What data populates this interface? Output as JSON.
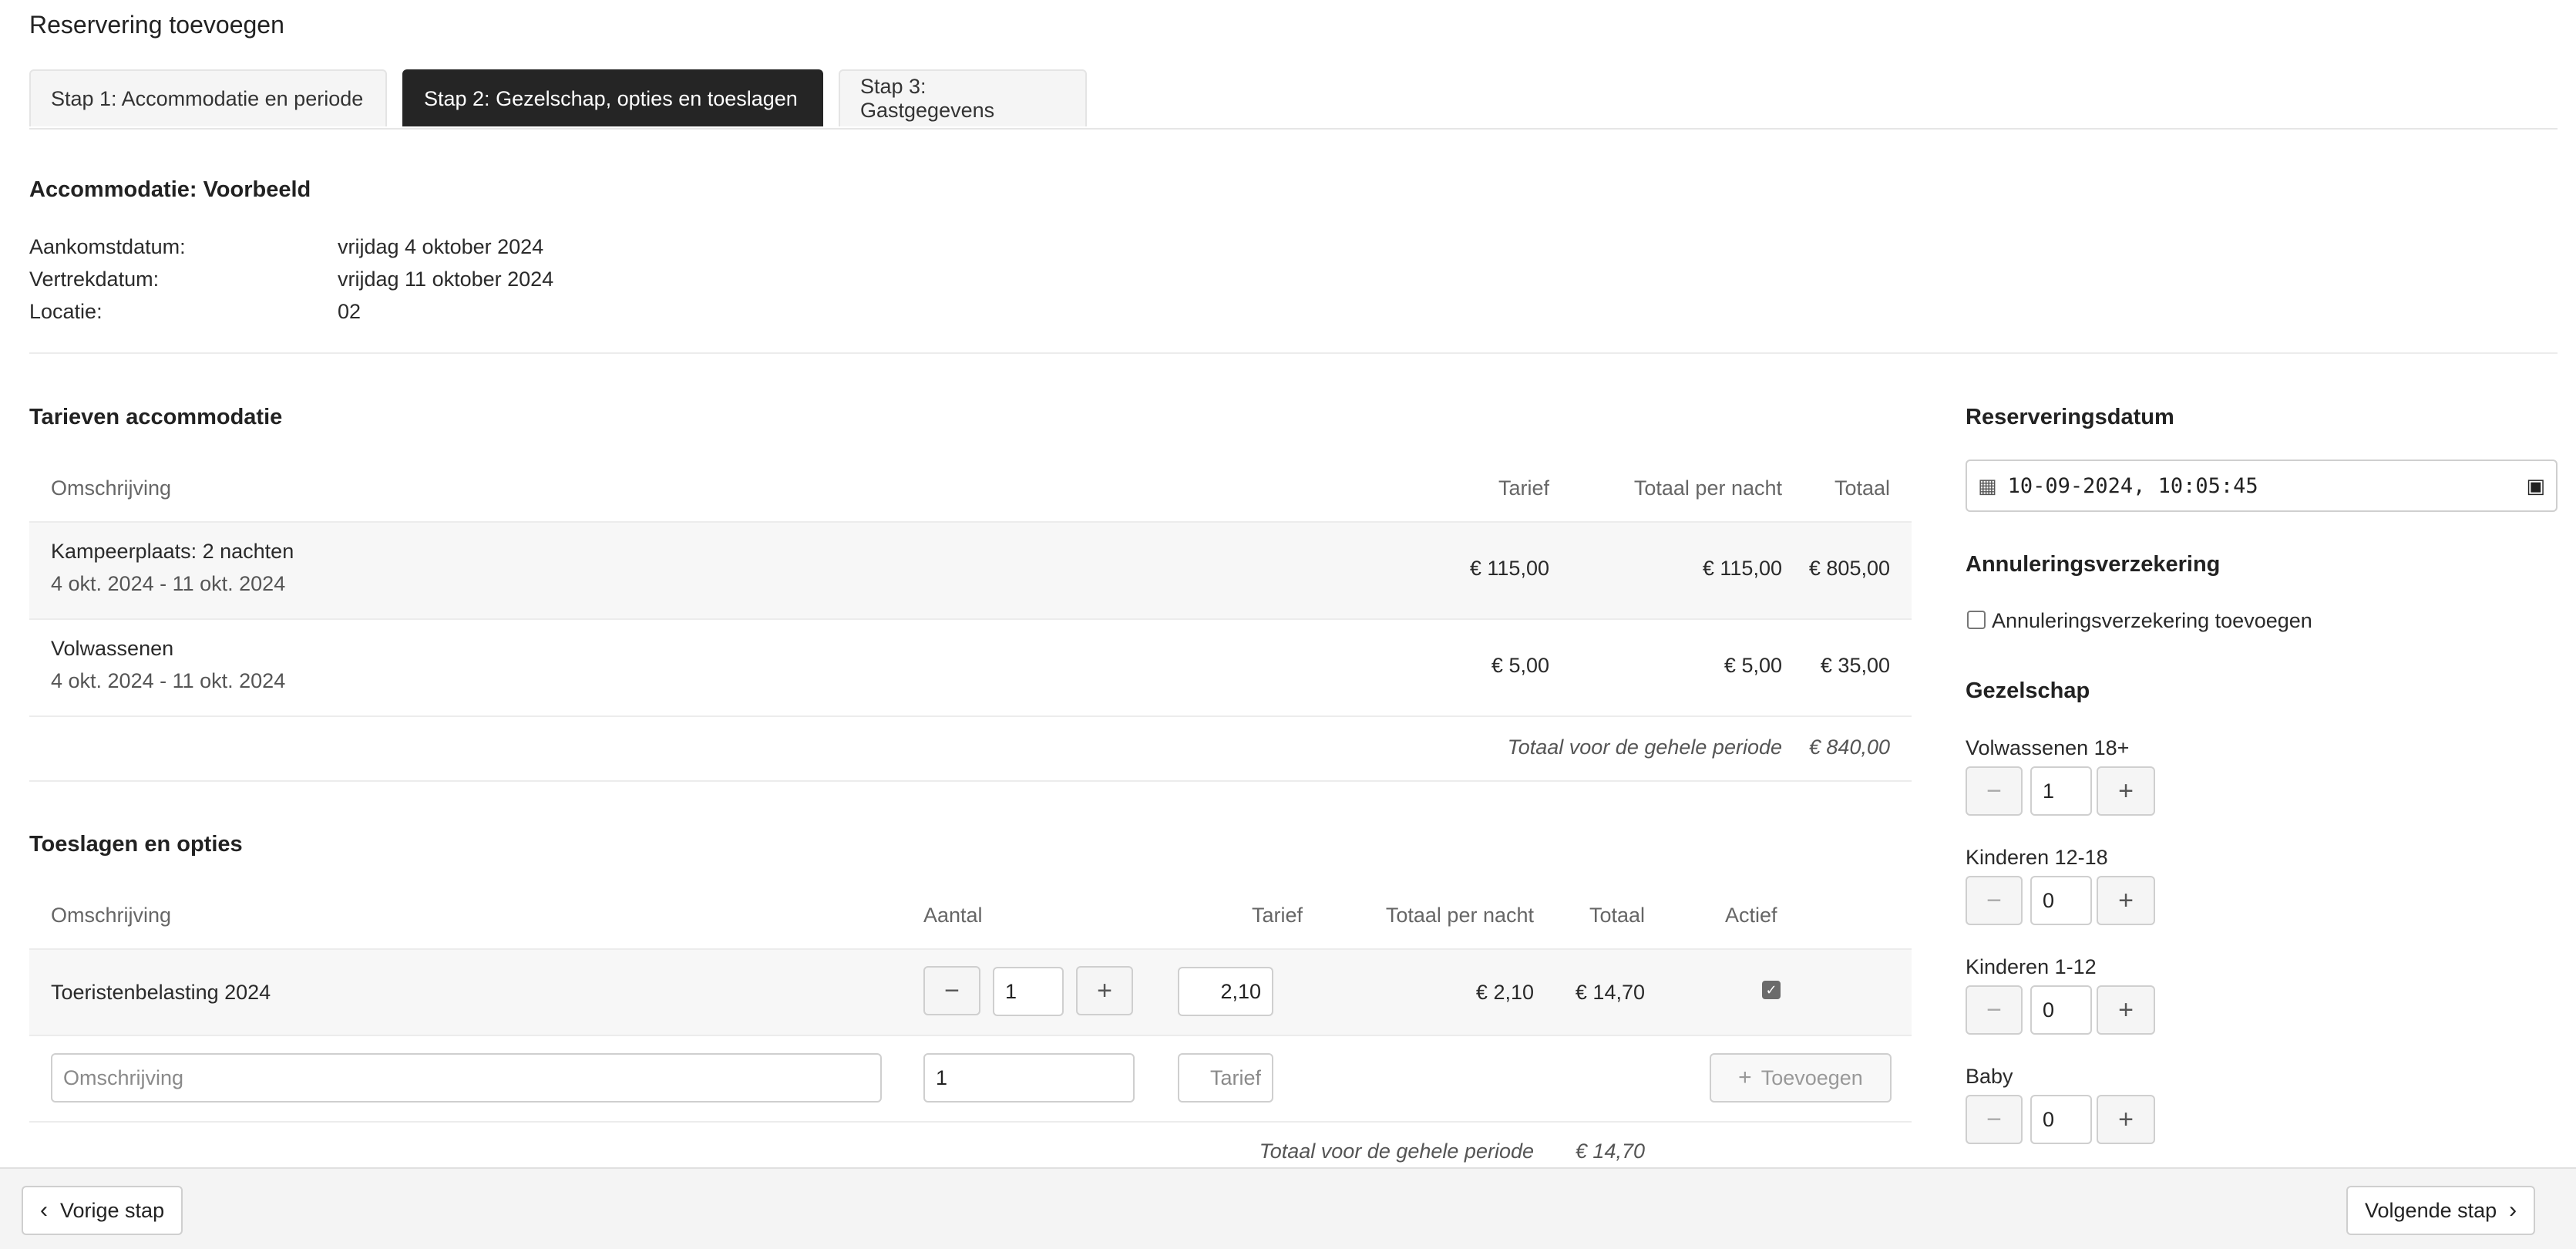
{
  "page": {
    "title": "Reservering toevoegen"
  },
  "tabs": [
    {
      "label": "Stap 1: Accommodatie en periode",
      "active": false
    },
    {
      "label": "Stap 2: Gezelschap, opties en toeslagen",
      "active": true
    },
    {
      "label": "Stap 3: Gastgegevens",
      "active": false
    }
  ],
  "accommodation": {
    "heading": "Accommodatie: Voorbeeld",
    "arrival_label": "Aankomstdatum:",
    "arrival_value": "vrijdag 4 oktober 2024",
    "departure_label": "Vertrekdatum:",
    "departure_value": "vrijdag 11 oktober 2024",
    "location_label": "Locatie:",
    "location_value": "02"
  },
  "rates": {
    "heading": "Tarieven accommodatie",
    "columns": [
      "Omschrijving",
      "Tarief",
      "Totaal per nacht",
      "Totaal"
    ],
    "rows": [
      {
        "desc": "Kampeerplaats: 2 nachten",
        "period": "4 okt. 2024 - 11 okt. 2024",
        "rate": "€ 115,00",
        "per_night": "€ 115,00",
        "total": "€ 805,00"
      },
      {
        "desc": "Volwassenen",
        "period": "4 okt. 2024 - 11 okt. 2024",
        "rate": "€ 5,00",
        "per_night": "€ 5,00",
        "total": "€ 35,00"
      }
    ],
    "footer_label": "Totaal voor de gehele periode",
    "footer_total": "€ 840,00"
  },
  "surcharges": {
    "heading": "Toeslagen en opties",
    "columns": [
      "Omschrijving",
      "Aantal",
      "Tarief",
      "Totaal per nacht",
      "Totaal",
      "Actief"
    ],
    "rows": [
      {
        "desc": "Toeristenbelasting 2024",
        "qty": "1",
        "rate": "2,10",
        "per_night": "€ 2,10",
        "total": "€ 14,70",
        "active": true
      }
    ],
    "new_row": {
      "desc_placeholder": "Omschrijving",
      "qty_value": "1",
      "rate_placeholder": "Tarief",
      "add_label": "Toevoegen"
    },
    "footer_label": "Totaal voor de gehele periode",
    "footer_total": "€ 14,70"
  },
  "sidebar": {
    "reservation_date_heading": "Reserveringsdatum",
    "reservation_date_value": "10-09-2024, 10:05:45",
    "insurance_heading": "Annuleringsverzekering",
    "insurance_label": "Annuleringsverzekering toevoegen",
    "insurance_checked": false,
    "party_heading": "Gezelschap",
    "party": [
      {
        "label": "Volwassenen 18+",
        "value": "1"
      },
      {
        "label": "Kinderen 12-18",
        "value": "0"
      },
      {
        "label": "Kinderen 1-12",
        "value": "0"
      },
      {
        "label": "Baby",
        "value": "0"
      }
    ]
  },
  "footer": {
    "prev_label": "Vorige stap",
    "next_label": "Volgende stap"
  }
}
